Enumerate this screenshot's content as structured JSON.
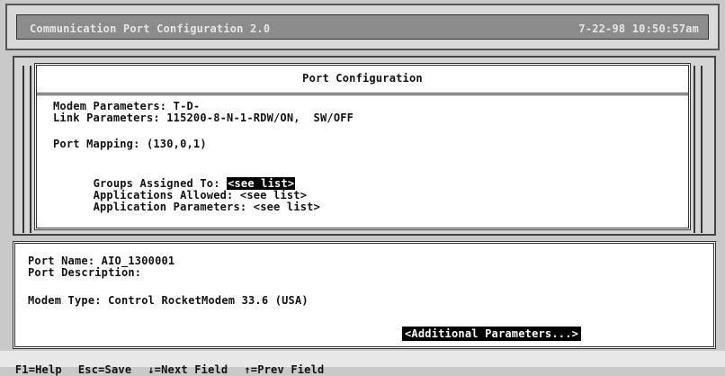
{
  "titlebar": {
    "app_title": "Communication Port Configuration  2.0",
    "datetime": "7-22-98 10:50:57am"
  },
  "port_configuration": {
    "title": "Port Configuration",
    "modem_parameters": "Modem Parameters: T-D-",
    "link_parameters": "Link Parameters: 115200-8-N-1-RDW/ON,  SW/OFF",
    "port_mapping": "Port Mapping: (130,0,1)",
    "groups_label": "Groups Assigned To: ",
    "groups_link": "<see list>",
    "applications_label": "Applications Allowed: ",
    "applications_link": "<see list>",
    "app_params_label": "Application Parameters: ",
    "app_params_link": "<see list>"
  },
  "detail": {
    "port_name": "Port Name: AIO_1300001",
    "port_description": "Port Description:",
    "modem_type": "Modem Type: Control RocketModem 33.6 (USA)",
    "additional_button": "<Additional Parameters...>"
  },
  "function_keys": [
    "F1=Help",
    "Esc=Save",
    "↓=Next Field",
    "↑=Prev Field"
  ]
}
